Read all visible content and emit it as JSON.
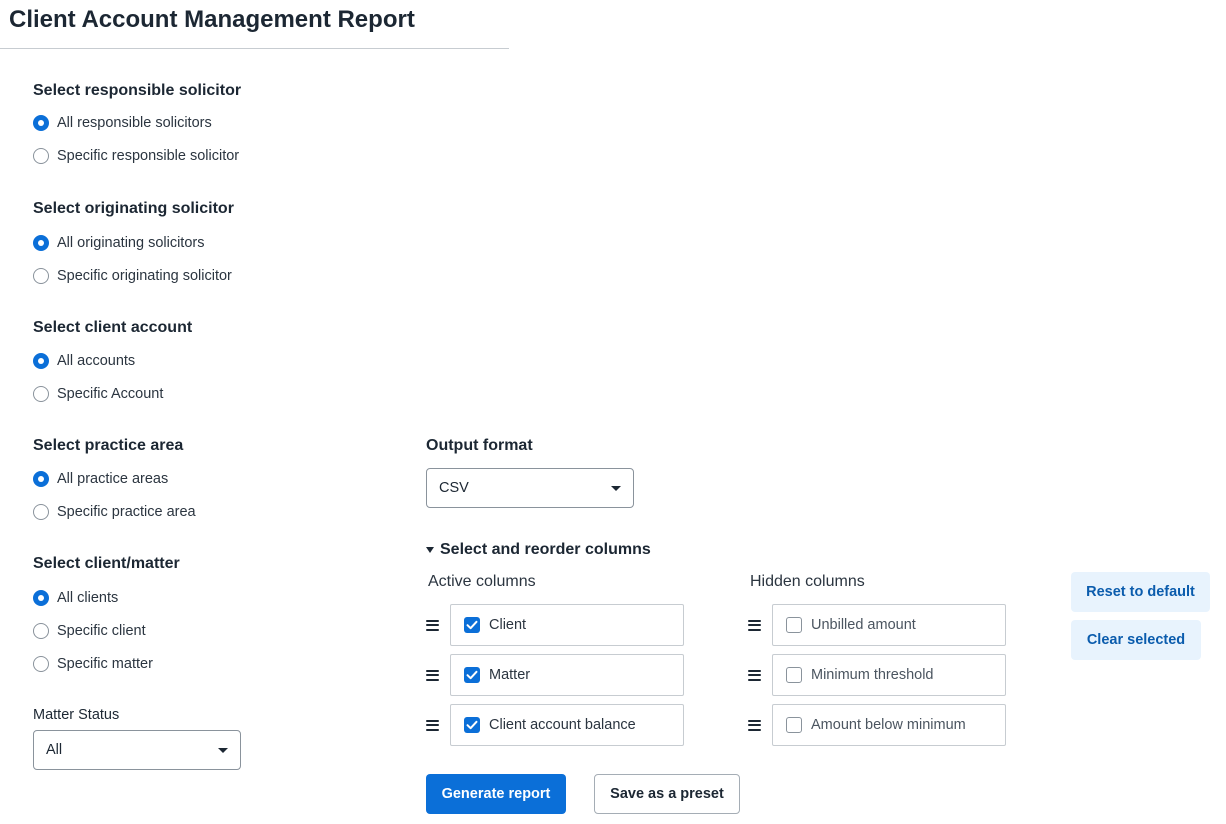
{
  "page_title": "Client Account Management Report",
  "filters": [
    {
      "title": "Select responsible solicitor",
      "options": [
        {
          "label": "All responsible solicitors",
          "selected": true
        },
        {
          "label": "Specific responsible solicitor",
          "selected": false
        }
      ]
    },
    {
      "title": "Select originating solicitor",
      "options": [
        {
          "label": "All originating solicitors",
          "selected": true
        },
        {
          "label": "Specific originating solicitor",
          "selected": false
        }
      ]
    },
    {
      "title": "Select client account",
      "options": [
        {
          "label": "All accounts",
          "selected": true
        },
        {
          "label": "Specific Account",
          "selected": false
        }
      ]
    },
    {
      "title": "Select practice area",
      "options": [
        {
          "label": "All practice areas",
          "selected": true
        },
        {
          "label": "Specific practice area",
          "selected": false
        }
      ]
    },
    {
      "title": "Select client/matter",
      "options": [
        {
          "label": "All clients",
          "selected": true
        },
        {
          "label": "Specific client",
          "selected": false
        },
        {
          "label": "Specific matter",
          "selected": false
        }
      ]
    }
  ],
  "matter_status": {
    "label": "Matter Status",
    "value": "All"
  },
  "output_format": {
    "label": "Output format",
    "value": "CSV"
  },
  "columns_section": {
    "title": "Select and reorder columns",
    "active_heading": "Active columns",
    "hidden_heading": "Hidden columns",
    "active": [
      {
        "label": "Client",
        "checked": true
      },
      {
        "label": "Matter",
        "checked": true
      },
      {
        "label": "Client account balance",
        "checked": true
      }
    ],
    "hidden": [
      {
        "label": "Unbilled amount",
        "checked": false
      },
      {
        "label": "Minimum threshold",
        "checked": false
      },
      {
        "label": "Amount below minimum",
        "checked": false
      }
    ],
    "reset_label": "Reset to default",
    "clear_label": "Clear selected"
  },
  "actions": {
    "generate_label": "Generate report",
    "preset_label": "Save as a preset"
  },
  "colors": {
    "accent": "#0b6fd8",
    "soft_button_bg": "#e8f3fd",
    "soft_button_text": "#0b5cad"
  }
}
